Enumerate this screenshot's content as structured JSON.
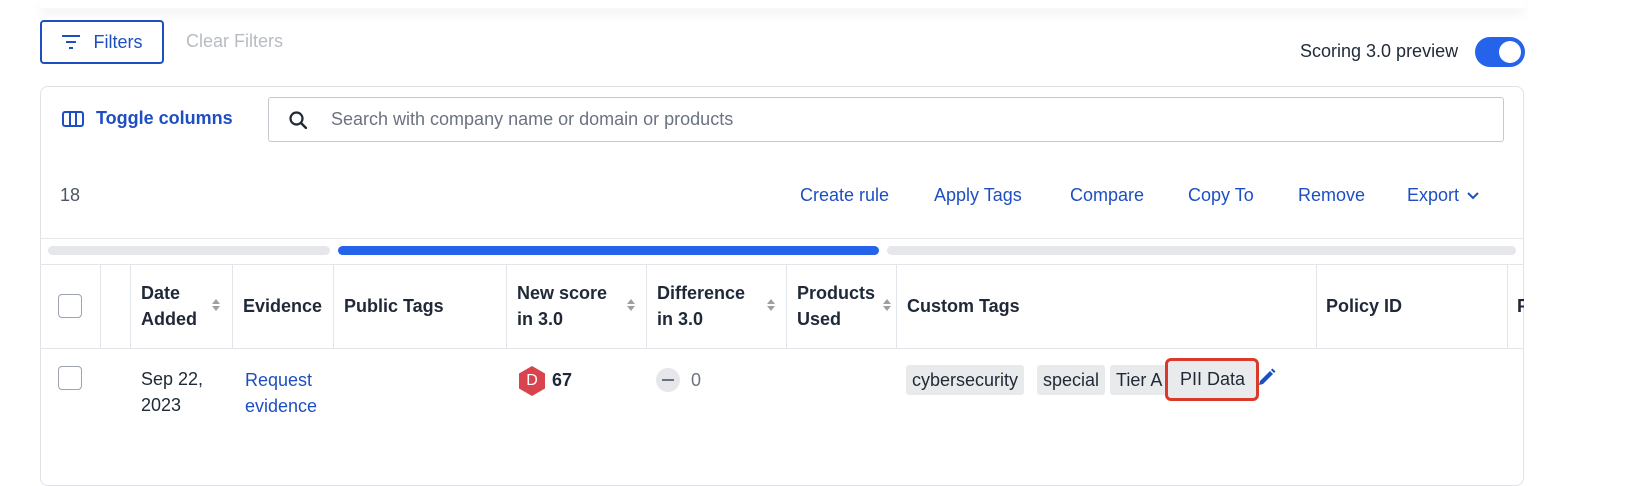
{
  "toolbar": {
    "filters_label": "Filters",
    "clear_filters_label": "Clear Filters",
    "scoring_preview_label": "Scoring 3.0 preview",
    "scoring_preview_on": true
  },
  "panel": {
    "toggle_columns_label": "Toggle columns",
    "search_placeholder": "Search with company name or domain or products",
    "result_count": "18",
    "actions": {
      "create_rule": "Create rule",
      "apply_tags": "Apply Tags",
      "compare": "Compare",
      "copy_to": "Copy To",
      "remove": "Remove",
      "export": "Export"
    }
  },
  "table": {
    "headers": {
      "date_added_1": "Date",
      "date_added_2": "Added",
      "evidence": "Evidence",
      "public_tags": "Public Tags",
      "new_score_1": "New score",
      "new_score_2": "in 3.0",
      "difference_1": "Difference",
      "difference_2": "in 3.0",
      "products_1": "Products",
      "products_2": "Used",
      "custom_tags": "Custom Tags",
      "policy_id": "Policy ID",
      "next_col": "P"
    },
    "rows": [
      {
        "date_1": "Sep 22,",
        "date_2": "2023",
        "evidence_1": "Request",
        "evidence_2": "evidence",
        "grade": "D",
        "score": "67",
        "difference": "0",
        "custom_tags": [
          "cybersecurity",
          "special",
          "Tier A",
          "PII Data"
        ]
      }
    ]
  },
  "colors": {
    "accent": "#1e4fc2",
    "toggle": "#2563eb",
    "grade_d": "#d9434e",
    "highlight": "#d93a2b"
  }
}
